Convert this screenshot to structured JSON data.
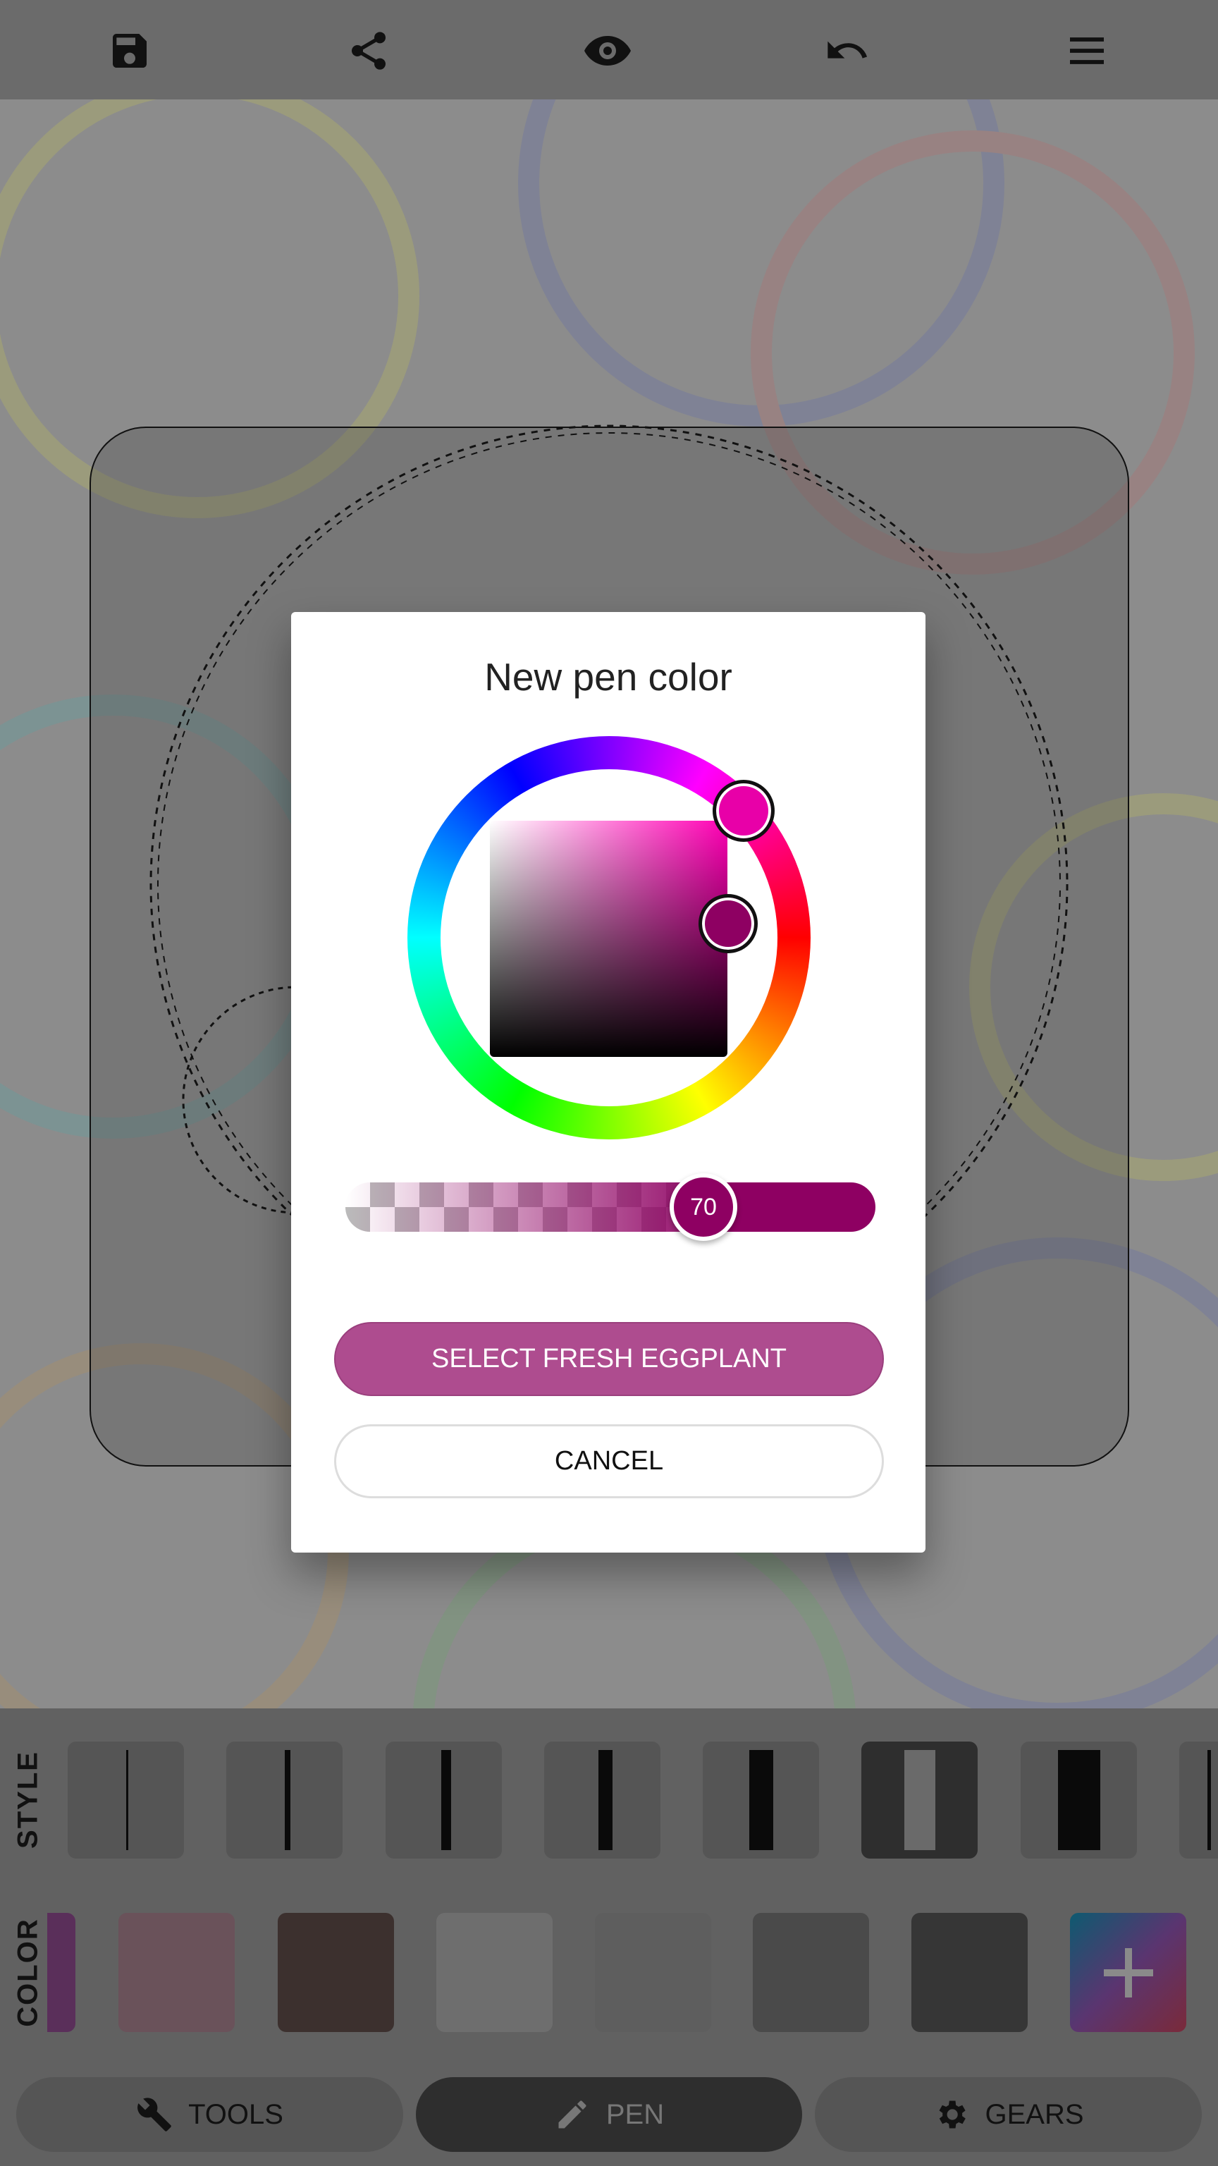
{
  "toolbar": {
    "icons": [
      "save-icon",
      "share-icon",
      "eye-icon",
      "undo-icon",
      "menu-icon"
    ]
  },
  "dialog": {
    "title": "New pen color",
    "selected_color": "#8e0062",
    "hue_color": "#ff00b4",
    "opacity": {
      "value": 70,
      "label": "70"
    },
    "select_label": "SELECT FRESH EGGPLANT",
    "cancel_label": "CANCEL",
    "accent": "#ae4c8f"
  },
  "style": {
    "label": "STYLE",
    "selected_index": 5,
    "count_visible": 8
  },
  "color": {
    "label": "COLOR",
    "swatches": [
      "#5a2f5a",
      "#6a525a",
      "#3c302e",
      "#6e6e6e",
      "#5e5e5e",
      "#4a4a4a",
      "#363636"
    ],
    "add_icon": "plus-icon"
  },
  "nav": {
    "items": [
      {
        "label": "TOOLS",
        "icon": "wrench-icon"
      },
      {
        "label": "PEN",
        "icon": "pencil-icon",
        "active": true
      },
      {
        "label": "GEARS",
        "icon": "gear-icon"
      }
    ]
  }
}
